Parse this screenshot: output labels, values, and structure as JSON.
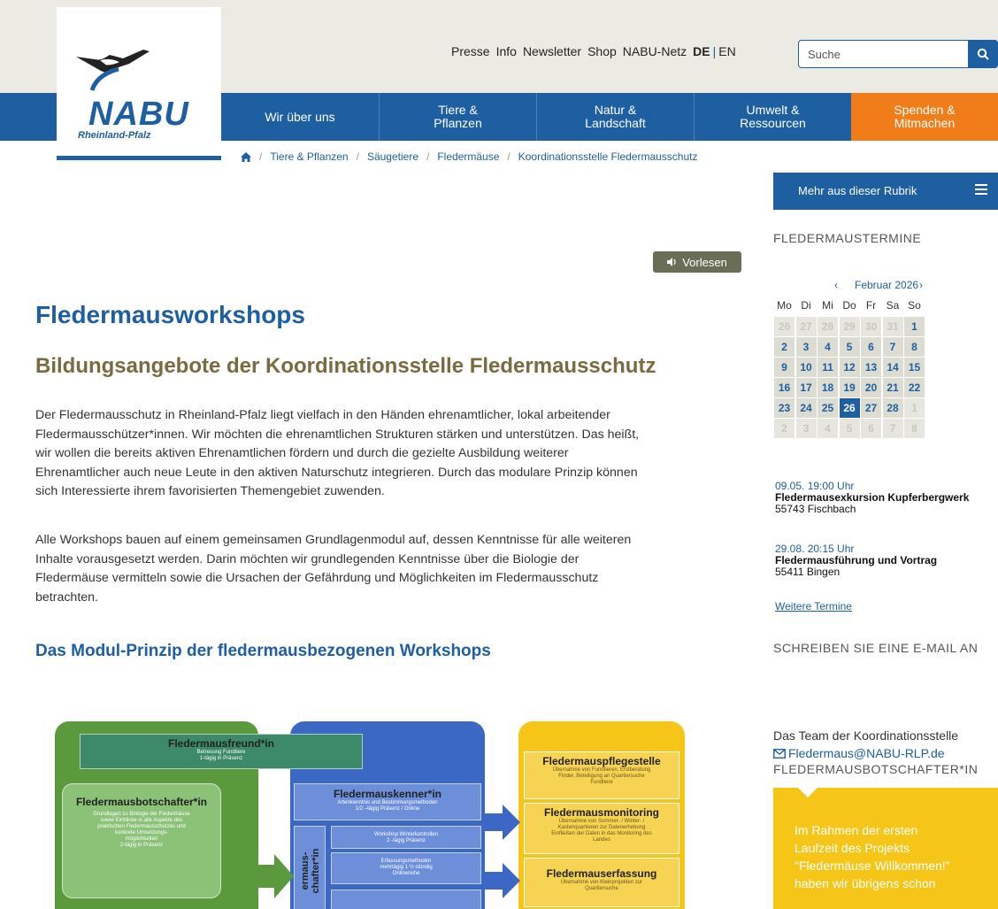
{
  "header": {
    "logo": {
      "name": "NABU",
      "subtitle": "Rheinland-Pfalz"
    },
    "meta_nav": [
      "Presse",
      "Info",
      "Newsletter",
      "Shop",
      "NABU-Netz"
    ],
    "lang": {
      "active": "DE",
      "sep": "|",
      "other": "EN"
    },
    "search": {
      "placeholder": "Suche"
    }
  },
  "main_nav": [
    {
      "l1": "Wir über uns",
      "l2": ""
    },
    {
      "l1": "Tiere &",
      "l2": "Pflanzen"
    },
    {
      "l1": "Natur &",
      "l2": "Landschaft"
    },
    {
      "l1": "Umwelt &",
      "l2": "Ressourcen"
    },
    {
      "l1": "Spenden &",
      "l2": "Mitmachen"
    }
  ],
  "breadcrumb": [
    "Tiere & Pflanzen",
    "Säugetiere",
    "Fledermäuse",
    "Koordinationsstelle Fledermausschutz"
  ],
  "vorlesen": "Vorlesen",
  "article": {
    "title": "Fledermausworkshops",
    "subtitle": "Bildungsangebote der Koordinationsstelle Fledermausschutz",
    "p1": [
      "Der Fledermausschutz in Rheinland-Pfalz liegt vielfach in den Händen ehrenamtlicher, lokal arbeitender",
      "Fledermausschützer*innen. Wir möchten die ehrenamtlichen Strukturen stärken und unterstützen. Das heißt,",
      "wir wollen die bereits aktiven Ehrenamtlichen fördern und durch die gezielte Ausbildung weiterer",
      "Ehrenamtlicher auch neue Leute in den aktiven Naturschutz integrieren. Durch das modulare Prinzip können",
      "sich Interessierte ihrem favorisierten Themengebiet zuwenden."
    ],
    "p2": [
      "Alle Workshops bauen auf einem gemeinsamen Grundlagenmodul auf, dessen Kenntnisse für alle weiteren",
      "Inhalte vorausgesetzt werden. Darin möchten wir grundlegenden Kenntnisse über die Biologie der",
      "Fledermäuse vermitteln sowie die Ursachen der Gefährdung und Möglichkeiten im Fledermausschutz",
      "betrachten."
    ],
    "h3": "Das Modul-Prinzip der fledermausbezogenen Workshops"
  },
  "diagram": {
    "freund": {
      "title": "Fledermausfreund*in",
      "sub1": "Betreuung Fundtiere",
      "sub2": "1-tägig in Präsenz"
    },
    "botschafter": {
      "title": "Fledermausbotschafter*in",
      "sub": [
        "Grundlagen zu Biologie der Fledermäuse",
        "sowie Einblicke in alle Aspekte des",
        "praktischen Fledermausschutzes und",
        "konkrete Umsetzungs-",
        "möglichkeiten",
        "2-tägig in Präsenz"
      ]
    },
    "kenner": {
      "title": "Fledermauskenner*in",
      "sub1": "Artenkenntnis und Bestimmungsmethoden",
      "sub2": "1/2 –tägig Präsenz / Online"
    },
    "vertical": [
      "ermaus-",
      "chafter*in"
    ],
    "sub_boxes": [
      {
        "l1": "Workshop Winterkontrollen",
        "l2": "2 -tägig Präsenz",
        "l3": ""
      },
      {
        "l1": "Erfassungsmethoden",
        "l2": "mehrtägig 1 ½ stündig",
        "l3": "Onlinereihe"
      }
    ],
    "pflege": {
      "title": "Fledermauspflegestelle",
      "sub": [
        "Übernahme von Fundtieren, Erstberatung",
        "Finder, Beteiligung an Quartiersuche",
        "Fundtiere"
      ]
    },
    "monitoring": {
      "title": "Fledermausmonitoring",
      "sub": [
        "Übernahme von Sommer- / Winter- /",
        "Kastenquartieren zur Datenerhebung",
        "Einfließen der Daten in das Monitoring des",
        "Landes"
      ]
    },
    "erfassung": {
      "title": "Fledermauserfassung",
      "sub": [
        "Übernahme von Kleinprojekten zur",
        "Quartiersuche"
      ]
    }
  },
  "sidebar": {
    "rubrik": "Mehr aus dieser Rubrik",
    "termine_heading": "FLEDERMAUSTERMINE",
    "calendar": {
      "prev": "‹",
      "month": "Februar 2026",
      "next": "›",
      "dow": [
        "Mo",
        "Di",
        "Mi",
        "Do",
        "Fr",
        "Sa",
        "So"
      ],
      "weeks": [
        [
          "26",
          "27",
          "28",
          "29",
          "30",
          "31",
          "1"
        ],
        [
          "2",
          "3",
          "4",
          "5",
          "6",
          "7",
          "8"
        ],
        [
          "9",
          "10",
          "11",
          "12",
          "13",
          "14",
          "15"
        ],
        [
          "16",
          "17",
          "18",
          "19",
          "20",
          "21",
          "22"
        ],
        [
          "23",
          "24",
          "25",
          "26",
          "27",
          "28",
          "1"
        ],
        [
          "2",
          "3",
          "4",
          "5",
          "6",
          "7",
          "8"
        ]
      ]
    },
    "events": [
      {
        "date": "09.05. 19:00 Uhr",
        "title": "Fledermausexkursion Kupferbergwerk",
        "place": "55743 Fischbach"
      },
      {
        "date": "29.08. 20:15 Uhr",
        "title": "Fledermausführung und Vortrag",
        "place": "55411 Bingen"
      }
    ],
    "weitere": "Weitere Termine",
    "email_heading": "SCHREIBEN SIE EINE E-MAIL AN",
    "team": "Das Team der Koordinationsstelle",
    "email": "Fledermaus@NABU-RLP.de",
    "botschafter_heading": "FLEDERMAUSBOTSCHAFTER*IN",
    "yellow_lines": [
      "Im Rahmen der ersten",
      "Laufzeit des Projekts",
      "\"Fledermäuse Willkommen!\"",
      "haben wir übrigens schon"
    ]
  },
  "colors": {
    "nabu_blue": "#1d5fa0",
    "orange": "#f07d1a",
    "olive": "#7a6a40",
    "yellow": "#f5c518",
    "green": "#5a9a3c"
  }
}
